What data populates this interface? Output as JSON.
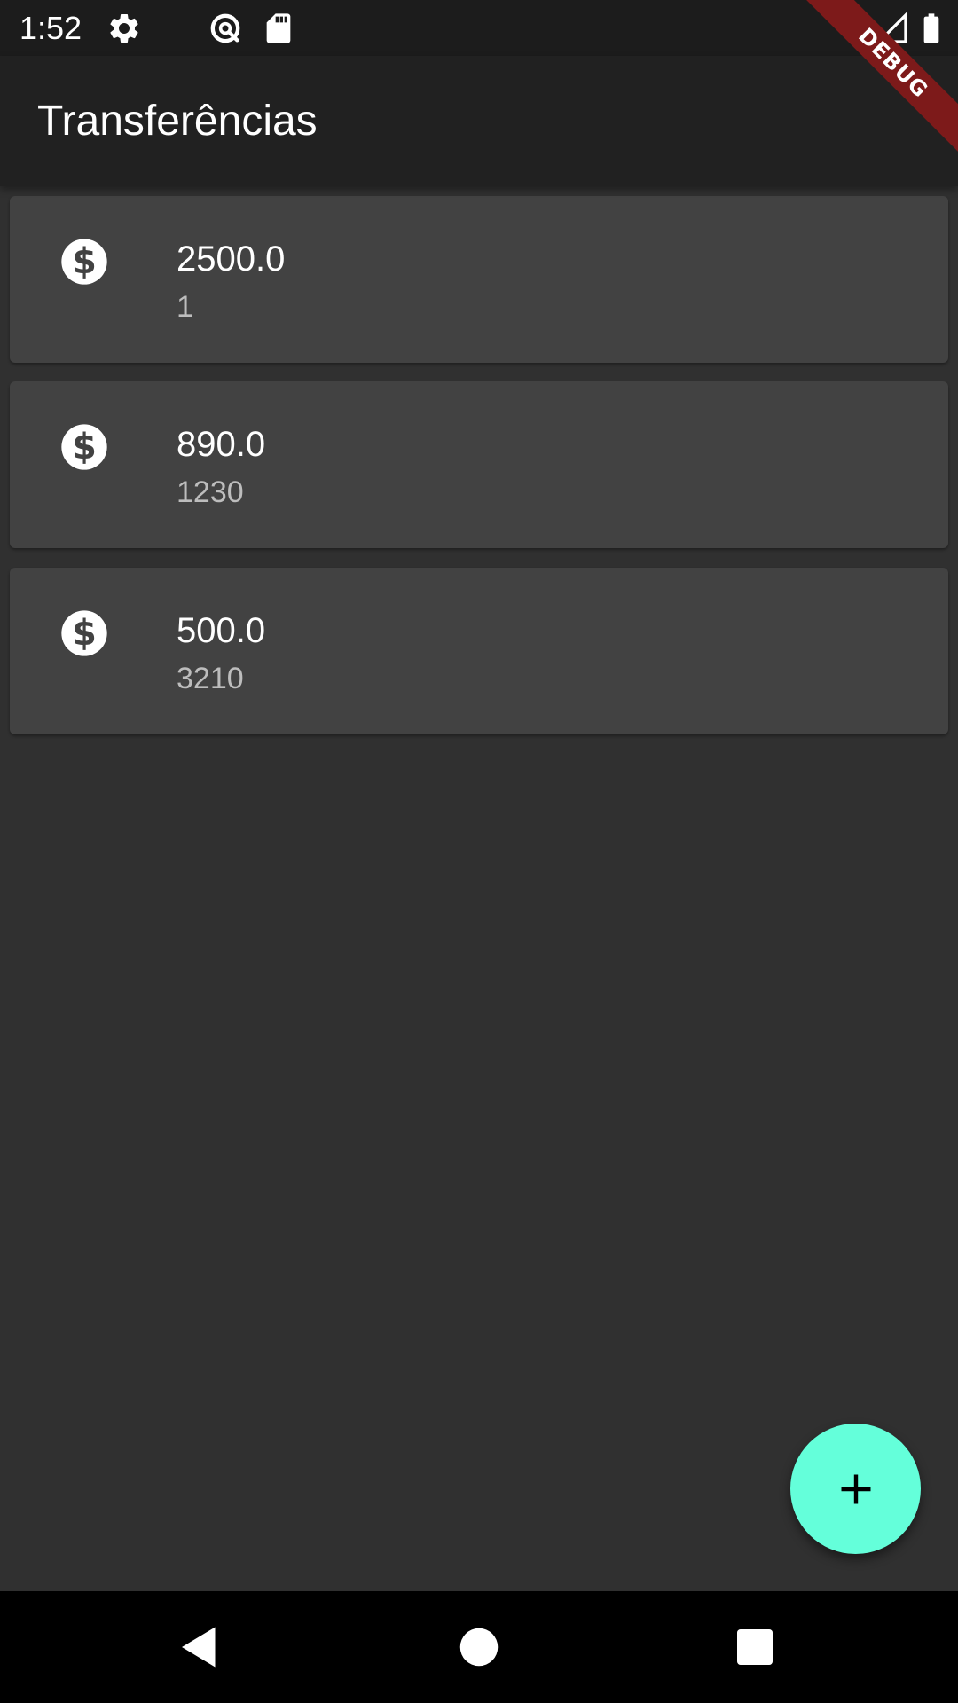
{
  "status_bar": {
    "time": "1:52",
    "icons": [
      "gear-icon",
      "data-saver-icon",
      "sd-card-icon",
      "signal-icon",
      "battery-icon"
    ]
  },
  "debug_banner": {
    "label": "DEBUG",
    "color": "#7d1a1a"
  },
  "app_bar": {
    "title": "Transferências"
  },
  "transfers": [
    {
      "icon": "monetization-icon",
      "value": "2500.0",
      "account": "1"
    },
    {
      "icon": "monetization-icon",
      "value": "890.0",
      "account": "1230"
    },
    {
      "icon": "monetization-icon",
      "value": "500.0",
      "account": "3210"
    }
  ],
  "fab": {
    "icon": "plus-icon",
    "color": "#64ffda"
  },
  "nav_bar": {
    "buttons": [
      "back-icon",
      "home-icon",
      "recents-icon"
    ]
  },
  "colors": {
    "background": "#303030",
    "app_bar": "#212121",
    "card": "#424242",
    "secondary_text": "#bdbdbd"
  }
}
